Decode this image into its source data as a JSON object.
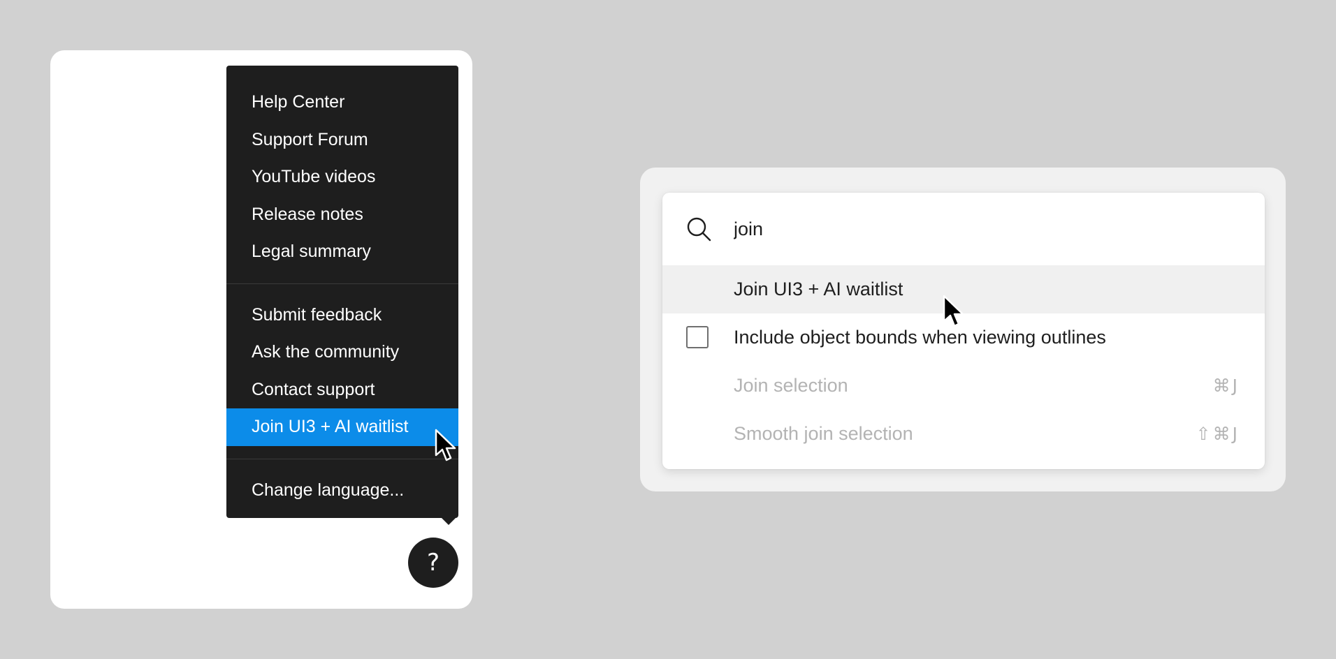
{
  "help_menu": {
    "groups": [
      [
        "Help Center",
        "Support Forum",
        "YouTube videos",
        "Release notes",
        "Legal summary"
      ],
      [
        "Submit feedback",
        "Ask the community",
        "Contact support",
        "Join UI3 + AI waitlist"
      ],
      [
        "Change language..."
      ]
    ],
    "active_item": "Join UI3 + AI waitlist",
    "help_button_label": "?",
    "active_color": "#0c8ce9",
    "menu_background": "#1e1e1e"
  },
  "quick_actions": {
    "search_value": "join",
    "results": [
      {
        "label": "Join UI3 + AI waitlist",
        "highlighted": true,
        "checkbox": false,
        "disabled": false,
        "shortcut": ""
      },
      {
        "label": "Include object bounds when viewing outlines",
        "highlighted": false,
        "checkbox": true,
        "disabled": false,
        "shortcut": ""
      },
      {
        "label": "Join selection",
        "highlighted": false,
        "checkbox": false,
        "disabled": true,
        "shortcut": "⌘J"
      },
      {
        "label": "Smooth join selection",
        "highlighted": false,
        "checkbox": false,
        "disabled": true,
        "shortcut": "⇧⌘J"
      }
    ]
  },
  "icons": {
    "search": "search-icon",
    "help": "question-mark-icon",
    "cursor": "mouse-pointer-icon",
    "checkbox": "checkbox-icon"
  }
}
